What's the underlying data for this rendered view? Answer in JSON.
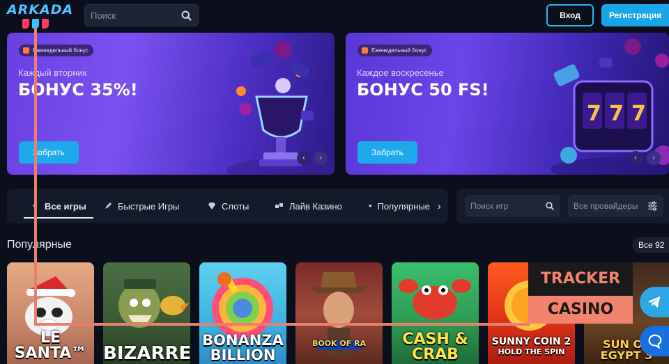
{
  "header": {
    "logo_text": "ARKADA",
    "search_placeholder": "Поиск",
    "login_label": "Вход",
    "register_label": "Регистрация"
  },
  "banners": [
    {
      "badge": "Еженедельный бонус",
      "subtitle": "Каждый вторник",
      "title": "БОНУС 35%!",
      "button": "Забрать"
    },
    {
      "badge": "Еженедельный бонус",
      "subtitle": "Каждое воскресенье",
      "title": "БОНУС 50 FS!",
      "button": "Забрать"
    }
  ],
  "tabs": [
    {
      "label": "Все игры",
      "icon": "rocket-icon"
    },
    {
      "label": "Быстрые Игры",
      "icon": "rocket-icon"
    },
    {
      "label": "Слоты",
      "icon": "diamond-icon"
    },
    {
      "label": "Лайв Казино",
      "icon": "dice-icon"
    },
    {
      "label": "Популярные",
      "icon": "shield-icon"
    }
  ],
  "filters": {
    "game_search_placeholder": "Поиск игр",
    "providers_label": "Все провайдеры"
  },
  "popular": {
    "title": "Популярные",
    "all_label": "Все 92",
    "games": [
      {
        "name_line1": "LE SANTA™",
        "name_line2": ""
      },
      {
        "name_line1": "BIZARRE",
        "name_line2": ""
      },
      {
        "name_line1": "BONANZA",
        "name_line2": "BILLION"
      },
      {
        "name_line1": "BOOK OF RA",
        "name_line2": ""
      },
      {
        "name_line1": "CASH &",
        "name_line2": "CRAB"
      },
      {
        "name_line1": "SUNNY COIN 2",
        "name_line2": "HOLD THE SPIN"
      },
      {
        "name_line1": "SUN OF EGYPT 3",
        "name_line2": ""
      }
    ]
  },
  "overlay": {
    "tracker_line1": "TRACKER",
    "tracker_line2": "CASINO"
  },
  "colors": {
    "accent": "#1ea9ec",
    "background": "#0b0f1c",
    "tracker": "#f2836f"
  }
}
